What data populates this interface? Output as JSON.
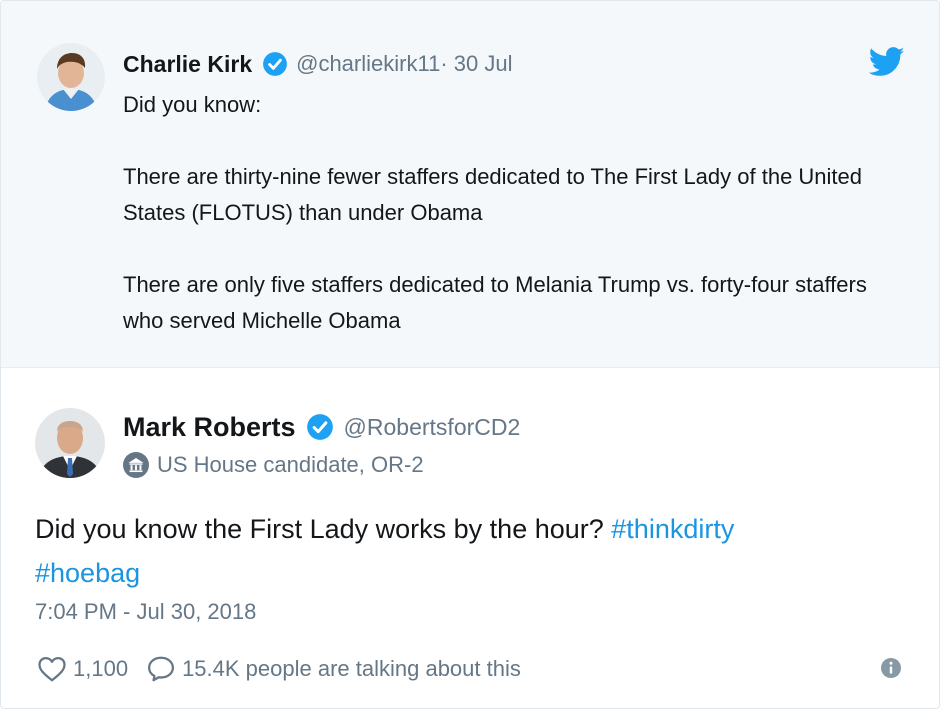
{
  "parent_tweet": {
    "name": "Charlie Kirk",
    "handle": "@charliekirk11",
    "date": "· 30 Jul",
    "body": [
      "Did you know:",
      "There are thirty-nine fewer staffers dedicated to The First Lady of the United States (FLOTUS) than under Obama",
      "There are only five staffers dedicated to Melania Trump vs. forty-four staffers who served Michelle Obama"
    ]
  },
  "main_tweet": {
    "name": "Mark Roberts",
    "handle": "@RobertsforCD2",
    "label": "US House candidate, OR-2",
    "body_text": "Did you know the First Lady works by the hour? ",
    "hashtags": [
      "#thinkdirty",
      "#hoebag"
    ],
    "timestamp": "7:04 PM - Jul 30, 2018",
    "likes": "1,100",
    "conversation": "15.4K people are talking about this"
  },
  "icons": {
    "verified": "verified-badge-icon",
    "twitter": "twitter-bird-icon",
    "label": "government-building-icon",
    "like": "heart-icon",
    "reply": "speech-bubble-icon",
    "info": "info-icon"
  },
  "colors": {
    "link": "#1b95e0",
    "verified": "#1da1f2",
    "muted": "#657786",
    "parent_bg": "#f5f8fa"
  }
}
